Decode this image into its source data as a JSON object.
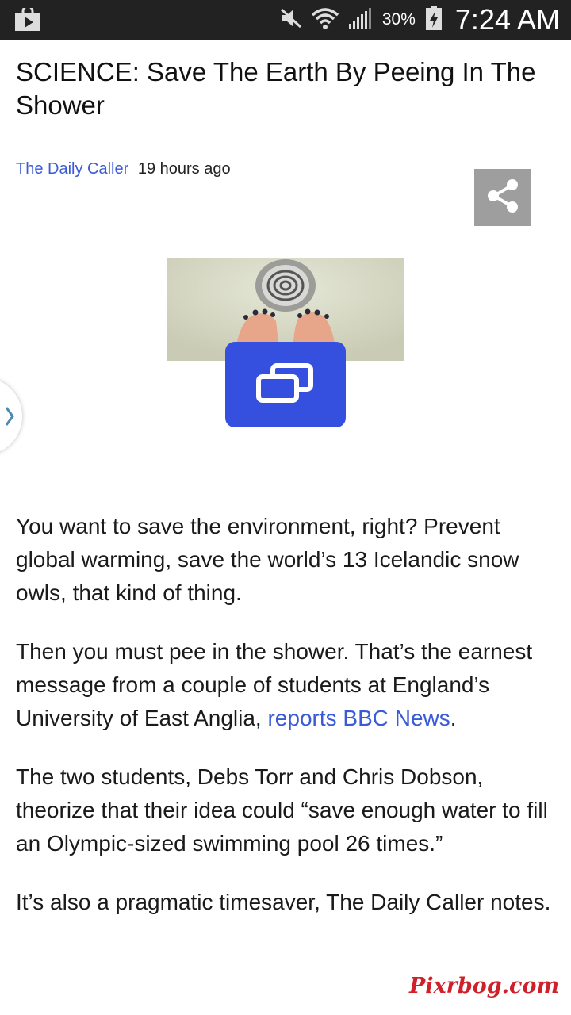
{
  "status_bar": {
    "battery_percent": "30%",
    "time": "7:24 AM",
    "icons": [
      "store-icon",
      "mute-icon",
      "wifi-icon",
      "signal-icon",
      "battery-charging-icon"
    ]
  },
  "article": {
    "title": "SCIENCE: Save The Earth By Peeing In The Shower",
    "source": "The Daily Caller",
    "time_ago": "19 hours ago",
    "paragraphs": {
      "p1": "You want to save the environment, right? Prevent global warming, save the world’s 13 Icelandic snow owls, that kind of thing.",
      "p2_before_link": "Then you must pee in the shower. That’s the earnest message from a couple of students at England’s University of East Anglia, ",
      "p2_link": "reports BBC News",
      "p2_after_link": ".",
      "p3": "The two students, Debs Torr and Chris Dobson, theorize that their idea could “save enough water to fill an Olympic-sized swimming pool 26 times.”",
      "p4": "It’s also a pragmatic timesaver, The Daily Caller notes."
    }
  },
  "icons": {
    "share": "share-icon",
    "expand": "expand-windows-icon",
    "side_tab": "chevron-right-icon"
  },
  "colors": {
    "link": "#3b5bd6",
    "expand_button": "#3550df",
    "share_button": "#9e9e9e",
    "status_bar": "#222222"
  },
  "watermark": "Pixrbog.com"
}
